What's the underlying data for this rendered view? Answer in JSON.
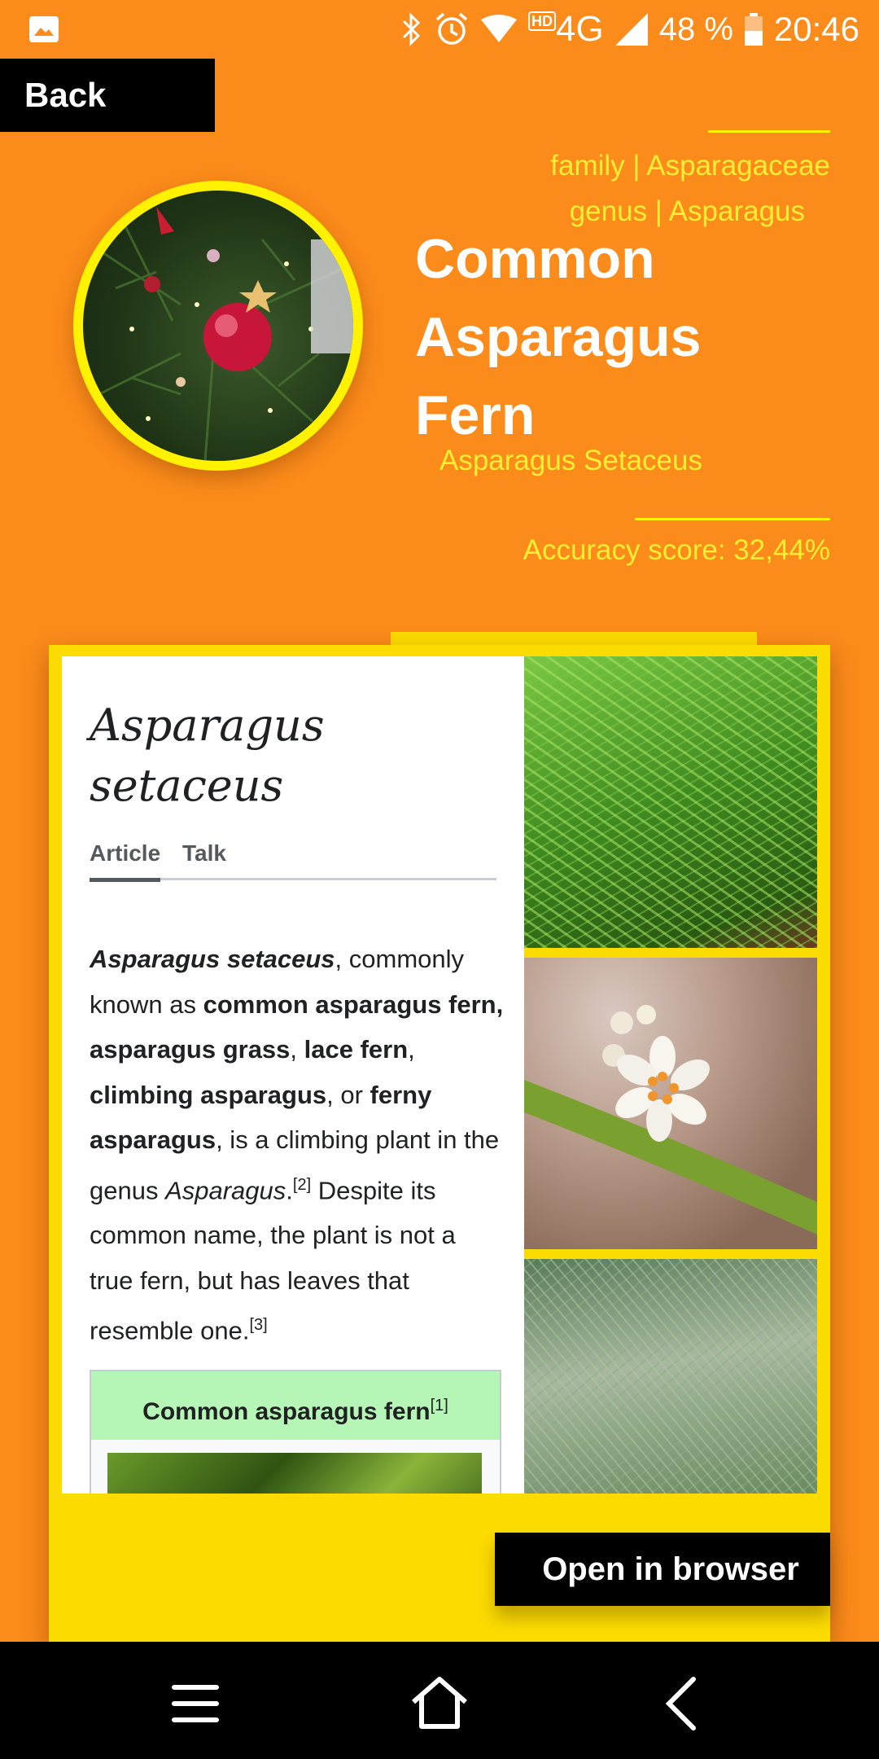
{
  "status_bar": {
    "network": "4G",
    "hd_badge": "HD",
    "battery": "48 %",
    "time": "20:46",
    "icons": [
      "gallery-icon",
      "bluetooth-icon",
      "alarm-icon",
      "wifi-icon",
      "signal-icon",
      "battery-icon"
    ]
  },
  "header": {
    "back_label": "Back"
  },
  "plant": {
    "family": "family | Asparagaceae",
    "genus": "genus | Asparagus",
    "title_line1": "Common",
    "title_line2": "Asparagus",
    "title_line3": "Fern",
    "scientific_name": "Asparagus Setaceus",
    "accuracy": "Accuracy score: 32,44%"
  },
  "wiki": {
    "title_line1": "Asparagus",
    "title_line2": "setaceus",
    "tab_article": "Article",
    "tab_talk": "Talk",
    "body": {
      "s1": "Asparagus setaceus",
      "s2": ", commonly known as ",
      "s3": "common asparagus fern, asparagus grass",
      "s4": ", ",
      "s5": "lace fern",
      "s6": ", ",
      "s7": "climbing asparagus",
      "s8": ", or ",
      "s9": "ferny asparagus",
      "s10": ", is a climbing plant in the genus ",
      "s11": "Asparagus",
      "s12": ".",
      "ref1": "[2]",
      "s13": " Despite its common name, the plant is not a true fern, but has leaves that resemble one.",
      "ref2": "[3]"
    },
    "infobox_title": "Common asparagus fern",
    "infobox_ref": "[1]"
  },
  "actions": {
    "open_browser_label": "Open in browser"
  },
  "colors": {
    "background": "#fb8b1a",
    "accent_yellow": "#fcdc00",
    "text_yellow": "#ffee33"
  },
  "navbar": {
    "icons": [
      "menu-icon",
      "home-icon",
      "back-arrow-icon"
    ]
  }
}
